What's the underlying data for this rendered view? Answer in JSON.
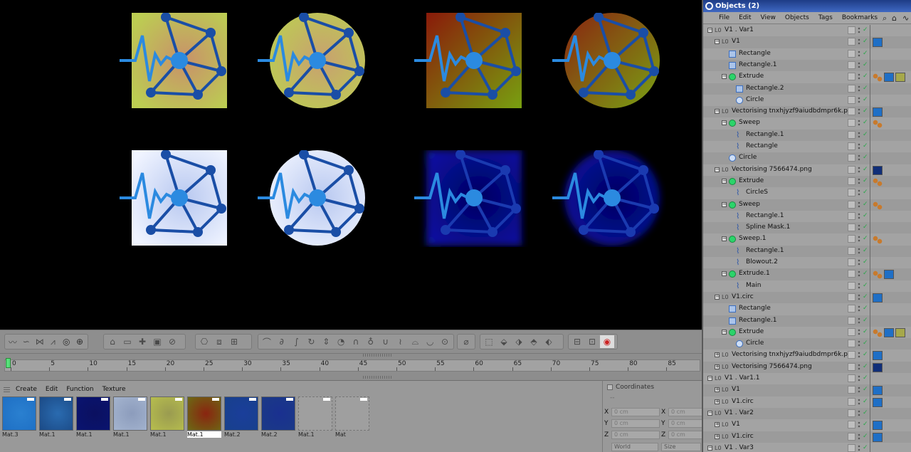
{
  "objects_panel": {
    "title": "Objects (2)",
    "menu": [
      "File",
      "Edit",
      "View",
      "Objects",
      "Tags",
      "Bookmarks"
    ],
    "rows": [
      {
        "label": "V1 . Var1",
        "depth": 0,
        "icon": "null-icon",
        "expanded": true,
        "tags": []
      },
      {
        "label": "V1",
        "depth": 1,
        "icon": "null-icon",
        "expanded": true,
        "tags": [
          "material-blue"
        ]
      },
      {
        "label": "Rectangle",
        "depth": 2,
        "icon": "rectangle-spline-icon",
        "tags": []
      },
      {
        "label": "Rectangle.1",
        "depth": 2,
        "icon": "rectangle-spline-icon",
        "tags": []
      },
      {
        "label": "Extrude",
        "depth": 2,
        "icon": "extrude-icon",
        "expanded": true,
        "tags": [
          "phong-tag",
          "material-blue",
          "material-olive"
        ]
      },
      {
        "label": "Rectangle.2",
        "depth": 3,
        "icon": "rectangle-spline-icon",
        "tags": []
      },
      {
        "label": "Circle",
        "depth": 3,
        "icon": "circle-spline-icon",
        "tags": []
      },
      {
        "label": "Vectorising tnxhjyzf9aiudbdmpr6k.png",
        "depth": 1,
        "icon": "null-icon",
        "expanded": true,
        "tags": [
          "material-blue"
        ]
      },
      {
        "label": "Sweep",
        "depth": 2,
        "icon": "sweep-icon",
        "expanded": true,
        "tags": [
          "phong-tag"
        ]
      },
      {
        "label": "Rectangle.1",
        "depth": 3,
        "icon": "spline-icon",
        "tags": []
      },
      {
        "label": "Rectangle",
        "depth": 3,
        "icon": "spline-icon",
        "tags": []
      },
      {
        "label": "Circle",
        "depth": 2,
        "icon": "circle-spline-icon",
        "tags": []
      },
      {
        "label": "Vectorising 7566474.png",
        "depth": 1,
        "icon": "null-icon",
        "expanded": true,
        "tags": [
          "material-navy"
        ]
      },
      {
        "label": "Extrude",
        "depth": 2,
        "icon": "extrude-icon",
        "expanded": true,
        "tags": [
          "phong-tag"
        ]
      },
      {
        "label": "CircleS",
        "depth": 3,
        "icon": "spline-icon",
        "tags": []
      },
      {
        "label": "Sweep",
        "depth": 2,
        "icon": "sweep-icon",
        "expanded": true,
        "tags": [
          "phong-tag"
        ]
      },
      {
        "label": "Rectangle.1",
        "depth": 3,
        "icon": "spline-icon",
        "tags": []
      },
      {
        "label": "Spline Mask.1",
        "depth": 3,
        "icon": "spline-icon",
        "tags": []
      },
      {
        "label": "Sweep.1",
        "depth": 2,
        "icon": "sweep-icon",
        "expanded": true,
        "tags": [
          "phong-tag"
        ]
      },
      {
        "label": "Rectangle.1",
        "depth": 3,
        "icon": "spline-icon",
        "tags": []
      },
      {
        "label": "Blowout.2",
        "depth": 3,
        "icon": "spline-icon",
        "tags": []
      },
      {
        "label": "Extrude.1",
        "depth": 2,
        "icon": "extrude-icon",
        "expanded": true,
        "tags": [
          "phong-tag",
          "material-blue"
        ]
      },
      {
        "label": "Main",
        "depth": 3,
        "icon": "spline-icon",
        "tags": []
      },
      {
        "label": "V1.circ",
        "depth": 1,
        "icon": "null-icon",
        "expanded": true,
        "tags": [
          "material-blue"
        ]
      },
      {
        "label": "Rectangle",
        "depth": 2,
        "icon": "rectangle-spline-icon",
        "tags": []
      },
      {
        "label": "Rectangle.1",
        "depth": 2,
        "icon": "rectangle-spline-icon",
        "tags": []
      },
      {
        "label": "Extrude",
        "depth": 2,
        "icon": "extrude-icon",
        "expanded": true,
        "tags": [
          "phong-tag",
          "material-blue",
          "material-olive"
        ]
      },
      {
        "label": "Circle",
        "depth": 3,
        "icon": "circle-spline-icon",
        "tags": []
      },
      {
        "label": "Vectorising tnxhjyzf9aiudbdmpr6k.png",
        "depth": 1,
        "icon": "null-icon",
        "expanded": false,
        "tags": [
          "material-blue"
        ]
      },
      {
        "label": "Vectorising 7566474.png",
        "depth": 1,
        "icon": "null-icon",
        "expanded": false,
        "tags": [
          "material-navy"
        ]
      },
      {
        "label": "V1 . Var1.1",
        "depth": 0,
        "icon": "null-icon",
        "expanded": true,
        "tags": []
      },
      {
        "label": "V1",
        "depth": 1,
        "icon": "null-icon",
        "expanded": false,
        "tags": [
          "material-blue"
        ]
      },
      {
        "label": "V1.circ",
        "depth": 1,
        "icon": "null-icon",
        "expanded": false,
        "tags": [
          "material-blue"
        ]
      },
      {
        "label": "V1 . Var2",
        "depth": 0,
        "icon": "null-icon",
        "expanded": true,
        "tags": []
      },
      {
        "label": "V1",
        "depth": 1,
        "icon": "null-icon",
        "expanded": false,
        "tags": [
          "material-blue"
        ]
      },
      {
        "label": "V1.circ",
        "depth": 1,
        "icon": "null-icon",
        "expanded": false,
        "tags": [
          "material-blue"
        ]
      },
      {
        "label": "V1 . Var3",
        "depth": 0,
        "icon": "null-icon",
        "expanded": true,
        "tags": []
      }
    ]
  },
  "timeline": {
    "ticks": [
      "0",
      "5",
      "10",
      "15",
      "20",
      "25",
      "30",
      "35",
      "40",
      "45",
      "50",
      "55",
      "60",
      "65",
      "70",
      "75",
      "80",
      "85"
    ],
    "current_frame": "0"
  },
  "material_manager": {
    "menu": [
      "Create",
      "Edit",
      "Function",
      "Texture"
    ],
    "materials": [
      {
        "name": "Mat.3",
        "color": "#1e6fc4",
        "color2": "#2a80d0",
        "selected": false,
        "empty": false
      },
      {
        "name": "Mat.1",
        "color": "#1b4a86",
        "color2": "#2a6bb0",
        "selected": false,
        "empty": false
      },
      {
        "name": "Mat.1",
        "color": "#0a1470",
        "color2": "#0b1060",
        "selected": false,
        "empty": false
      },
      {
        "name": "Mat.1",
        "color": "#a4b4cf",
        "color2": "#8c9cbc",
        "selected": false,
        "empty": false
      },
      {
        "name": "Mat.1",
        "color": "#b7be4e",
        "color2": "#9a9b50",
        "selected": false,
        "empty": false
      },
      {
        "name": "Mat.1",
        "color": "#6b6a14",
        "color2": "#8a2410",
        "selected": true,
        "empty": false
      },
      {
        "name": "Mat.2",
        "color": "#18408c",
        "color2": "#1a3e9a",
        "selected": false,
        "empty": false
      },
      {
        "name": "Mat.2",
        "color": "#1b3a86",
        "color2": "#1a3090",
        "selected": false,
        "empty": false
      },
      {
        "name": "Mat.1",
        "color": "#a0a0a0",
        "color2": "#a0a0a0",
        "selected": false,
        "empty": true
      },
      {
        "name": "Mat",
        "color": "#a0a0a0",
        "color2": "#a0a0a0",
        "selected": false,
        "empty": true
      }
    ]
  },
  "coordinates": {
    "title": "Coordinates",
    "header_dash": "--",
    "axes": [
      "X",
      "Y",
      "Z"
    ],
    "value": "0 cm",
    "world_select": "World",
    "size_select": "Size"
  },
  "viewport": {
    "logos": [
      {
        "shape": "square",
        "bg": [
          "#bccd52",
          "#c8916a"
        ],
        "net": "#1a4ea6",
        "wave": "#2b8ae0",
        "center": "#2b8ae0"
      },
      {
        "shape": "circle",
        "bg": [
          "#bccd52",
          "#c8a070"
        ],
        "net": "#1a4ea6",
        "wave": "#2b8ae0",
        "center": "#2b8ae0"
      },
      {
        "shape": "square",
        "bg": [
          "#8a1a0a",
          "#78a010"
        ],
        "net": "#1a4ea6",
        "wave": "#2b8ae0",
        "center": "#2b8ae0"
      },
      {
        "shape": "circle",
        "bg": [
          "#8a2410",
          "#7aa214"
        ],
        "net": "#1a4ea6",
        "wave": "#2b8ae0",
        "center": "#2b8ae0"
      },
      {
        "shape": "square",
        "bg": [
          "#f0f4ff",
          "#b8c8f0"
        ],
        "net": "#1a4ea6",
        "wave": "#2b8ae0",
        "center": "#2b8ae0"
      },
      {
        "shape": "circle",
        "bg": [
          "#f0f4ff",
          "#b8c8f0"
        ],
        "net": "#1a4ea6",
        "wave": "#2b8ae0",
        "center": "#2b8ae0"
      },
      {
        "shape": "square-glow",
        "bg": [
          "#0a12a0",
          "#000060"
        ],
        "net": "#1a3ab0",
        "wave": "#2b8ae0",
        "center": "#2b8ae0"
      },
      {
        "shape": "circle-glow",
        "bg": [
          "#0a12a0",
          "#000060"
        ],
        "net": "#1a3ab0",
        "wave": "#2b8ae0",
        "center": "#2b8ae0"
      }
    ]
  }
}
